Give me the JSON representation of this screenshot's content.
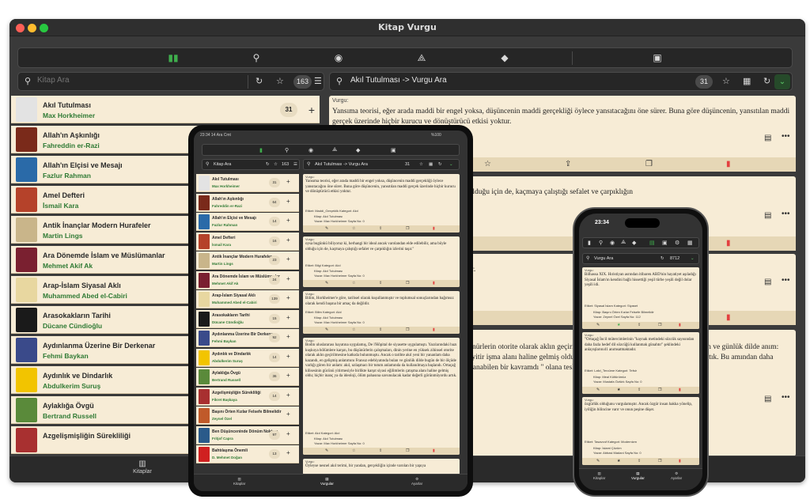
{
  "app": {
    "title": "Kitap Vurgu"
  },
  "colors": {
    "accent": "#3fae4d",
    "card": "#f7ecd6",
    "bar": "#e6d7b6",
    "danger": "#e34040",
    "author": "#2f7a34"
  },
  "toolbar": {
    "icons": [
      "book-icon",
      "user-search-icon",
      "user-circle-icon",
      "shapes-icon",
      "tag-icon",
      "image-search-icon"
    ]
  },
  "left_search": {
    "placeholder": "Kitap Ara",
    "count": "163"
  },
  "right_search": {
    "breadcrumb": "Akıl Tutulması -> Vurgu Ara",
    "count": "31"
  },
  "books": [
    {
      "title": "Akıl Tutulması",
      "author": "Max Horkheimer",
      "count": "31",
      "color": "#e3e3e3"
    },
    {
      "title": "Allah'ın Aşkınlığı",
      "author": "Fahreddin er-Razi",
      "count": "",
      "color": "#7a2a1a"
    },
    {
      "title": "Allah'ın Elçisi ve Mesajı",
      "author": "Fazlur Rahman",
      "count": "",
      "color": "#2a6aa8"
    },
    {
      "title": "Amel Defteri",
      "author": "İsmail Kara",
      "count": "",
      "color": "#b5422a"
    },
    {
      "title": "Antik İnançlar Modern Hurafeler",
      "author": "Martin Lings",
      "count": "",
      "color": "#c9b58a"
    },
    {
      "title": "Ara Dönemde İslam ve Müslümanlar",
      "author": "Mehmet Akif Ak",
      "count": "",
      "color": "#7a2030"
    },
    {
      "title": "Arap-İslam Siyasal Aklı",
      "author": "Muhammed Abed el-Cabiri",
      "count": "",
      "color": "#e8d7a0"
    },
    {
      "title": "Arasokakların Tarihi",
      "author": "Dücane Cündioğlu",
      "count": "",
      "color": "#1a1a1a"
    },
    {
      "title": "Aydınlanma Üzerine Bir Derkenar",
      "author": "Fehmi Baykan",
      "count": "",
      "color": "#3a4a8a"
    },
    {
      "title": "Aydınlık ve Dindarlık",
      "author": "Abdulkerim Suruş",
      "count": "",
      "color": "#f2c400"
    },
    {
      "title": "Aylaklığa Övgü",
      "author": "Bertrand Russell",
      "count": "",
      "color": "#5a8a3a"
    },
    {
      "title": "Azgelişmişliğin Sürekliliği",
      "author": "",
      "count": "",
      "color": "#a83030"
    }
  ],
  "quotes": [
    {
      "label": "Vurgu:",
      "text": "Yansıma teorisi, eğer arada maddi bir engel yoksa, düşüncenin maddi gerçekliği öylece yansıtacağını öne sürer. Buna göre düşüncenin, yansıtılan maddi gerçek üzerinde hiçbir kurucu ve dönüştürücü etkisi yoktur."
    },
    {
      "label": "",
      "text": "i ancak varolandan elde edilebilir, ama böyle olduğu için de, kaçmaya çalıştığı sefalet ve çarpıklığın"
    },
    {
      "label": "",
      "text": "sullanmıştır ve toplumsal sonuç                                                                                  naç da değildir."
    },
    {
      "label": "",
      "text": "Hôpital de siyasette uygulamış                                                             karşın, bu düşünürlerin otorite olarak aklın geçirilmesi                                                             yeni bir yananlam daha biyatında bulan ve günlük dilde                                                             anım: akıl, uzlaşmacı bir Ortaçağ kilisesinin gücünü yitir                                                             işma alanı haline gelmiş oldu; hiçbir inanç ya da ideoloj                                                             görünmüyordu artık. Bu amından daha insancaydı, ama                                                             larca daha kolay çekip y uyarlanabilen bir kavramdı                                                             \" olana teslim olma"
    }
  ],
  "tabs": {
    "books": "Kitaplar",
    "quotes": "Vurgular",
    "settings": "Ayarlar"
  },
  "tablet": {
    "status_time": "23:34",
    "status_date": "14 Ara Cmt",
    "status_right": "%100",
    "search_placeholder": "Kitap Ara",
    "search_count": "163",
    "breadcrumb": "Akıl Tutulması -> Vurgu Ara",
    "quote_count": "31",
    "books": [
      {
        "title": "Akıl Tutulması",
        "author": "Max Horkheimer",
        "count": "31",
        "color": "#e3e3e3"
      },
      {
        "title": "Allah'ın Aşkınlığı",
        "author": "Fahreddin er-Razi",
        "count": "64",
        "color": "#7a2a1a"
      },
      {
        "title": "Allah'ın Elçisi ve Mesajı",
        "author": "Fazlur Rahman",
        "count": "14",
        "color": "#2a6aa8"
      },
      {
        "title": "Amel Defteri",
        "author": "İsmail Kara",
        "count": "16",
        "color": "#b5422a"
      },
      {
        "title": "Antik İnançlar Modern Hurafeler",
        "author": "Martin Lings",
        "count": "23",
        "color": "#c9b58a"
      },
      {
        "title": "Ara Dönemde İslam ve Müslümanlar",
        "author": "Mehmet Akif Ak",
        "count": "24",
        "color": "#7a2030"
      },
      {
        "title": "Arap-İslam Siyasal Aklı",
        "author": "Muhammed Abed el-Cabiri",
        "count": "139",
        "color": "#e8d7a0"
      },
      {
        "title": "Arasokakların Tarihi",
        "author": "Dücane Cündioğlu",
        "count": "15",
        "color": "#1a1a1a"
      },
      {
        "title": "Aydınlanma Üzerine Bir Derkenar",
        "author": "Fehmi Baykan",
        "count": "92",
        "color": "#3a4a8a"
      },
      {
        "title": "Aydınlık ve Dindarlık",
        "author": "Abdulkerim Suruş",
        "count": "14",
        "color": "#f2c400"
      },
      {
        "title": "Aylaklığa Övgü",
        "author": "Bertrand Russell",
        "count": "36",
        "color": "#5a8a3a"
      },
      {
        "title": "Azgelişmişliğin Sürekliliği",
        "author": "Fikret Başkaya",
        "count": "14",
        "color": "#a83030"
      },
      {
        "title": "Başını Örten Kızlar Felsefe Bilmelidir",
        "author": "Zeynel Özel",
        "count": "",
        "color": "#c05a2a"
      },
      {
        "title": "Ben Düşünceninde Dönüm Noktası",
        "author": "Fritjof Capra",
        "count": "97",
        "color": "#2a5a8a"
      },
      {
        "title": "Bahtılaşma Önemli",
        "author": "D. Mehmet Doğan",
        "count": "13",
        "color": "#d02020"
      }
    ],
    "quotes": [
      {
        "label": "Vurgu:",
        "text": "Yansıma teorisi, eğer arada maddi bir engel yoksa, düşüncenin maddi gerçekliği öylece yansıtacağını öne sürer. Buna göre düşüncenin, yansıtılan maddi gerçek üzerinde hiçbir kurucu ve dönüştürücü etkisi yoktur.",
        "tags": "Etiket: Maddi_Gerçeklik   Kategori: Akıl",
        "book": "Kitap: Akıl Tutulması",
        "meta": "Yazar: Max Horkheimer   Sayfa No: 0"
      },
      {
        "label": "Vurgu:",
        "text": "oysa bugünkü biliyoruz ki, herhangi bir ideal ancak varolandan elde edilebilir, ama böyle olduğu için de, kaçmaya çalıştığı sefalet ve çarpıklığın izlerini taşır.\"",
        "tags": "Etiket: Bilgi   Kategori: Akıl",
        "book": "Kitap: Akıl Tutulması",
        "meta": "Yazar: Max Horkheimer   Sayfa No: 0"
      },
      {
        "label": "Vurgu:",
        "text": "Bilim, Horkheimer'e göre, tarihsel olarak kuşullanmıştır ve toplumsal sonuçlarından bağımsız olarak kendi başına bir amaç da değildir.",
        "tags": "Etiket: Bilim   Kategori: Akıl",
        "book": "Kitap: Akıl Tutulması",
        "meta": "Yazar: Max Horkheimer   Sayfa No: 0"
      },
      {
        "label": "Vurgu:",
        "text": "Bodin uluslararası hayatına uygulamış, De l'Hôpital de siyasette uygulamıştı. Yazılarındaki bazı kuşkuya bölümlere karşın, bu düşünürlerin çalışmaları, dinin yerine en yüksek zihinsel otorite olarak aklın geçirilmesine katkıda bulunmuştu. Ancak o tarihte akıl yeni bir yananlam daha kazandı, en gelişmiş anlatımını Fransız edebiyatında bulan ve günlük dilde bugün de bir ölçüde varlığı gören bir anlam: akıl, uzlaşmacı bir tutum anlamında da kullanılmaya başlandı. Ortaçağ kilisesinin gücünü yitirmesiyle birlikte karşıt siyasi eğilimlerin çatışma alanı haline gelmiş oldu; hiçbir inanç ya da ideoloji, ölüm pahasına savunulacak kadar değerli görünmüyordu artık.",
        "tags": "Etiket: Akıl   Kategori: Akıl",
        "book": "Kitap: Akıl Tutulması",
        "meta": "Yazar: Max Horkheimer   Sayfa No: 0"
      },
      {
        "label": "Vurgu:",
        "text": "Öyleyse nesnel akıl terimi, bir yandan, gerçekliğin içinde varolan bir yapıya",
        "tags": "",
        "book": "",
        "meta": ""
      }
    ]
  },
  "phone": {
    "status_time": "23:34",
    "search_placeholder": "Vurgu Ara",
    "count": "8712",
    "quotes": [
      {
        "label": "Vurgu:",
        "text": "Bilhassa XIX. Hıristiyan asrından itibaren ABD'nin hayatiyet aşıladığı Siyasal İslam'ın kendini bağlı hissettiği yeşil türbe yeşili değil dolar yeşili idi.",
        "tags": "Etiket: Siyasal İslam   Kategori: Siyaset",
        "book": "Kitap: Başını Örten Kızlar Felsefe Bilmelidir",
        "meta": "Yazar: Zeynel Özel   Sayfa No: 112"
      },
      {
        "label": "Vurgu:",
        "text": "\"Ortaçağ İncil mütercimlerinin \"kaynak metindeki sözcük sayısından daha fazla hedef dil sözcüğü kullanmak günahtır\" şeklindeki anlayışlarını41 anımsatmaktadır.",
        "tags": "Etiket: Lafzi_Tercüme   Kategori: Tefsir",
        "book": "Kitap: Meal Kültürümüz",
        "meta": "Yazar: Mustafa Öztürk   Sayfa No: 0"
      },
      {
        "label": "Vurgu:",
        "text": "özgürlük olduğunu vurgulamıştır. Ancak özgür insan hakka yönelip, iyiliğin bilincine varır ve onun peşine düşer.",
        "tags": "Etiket: Tasavvuf   Kategori: Modernizm",
        "book": "Kitap: İslami Çözüm",
        "meta": "Yazar: Abbasi Madani   Sayfa No: 0"
      }
    ]
  }
}
